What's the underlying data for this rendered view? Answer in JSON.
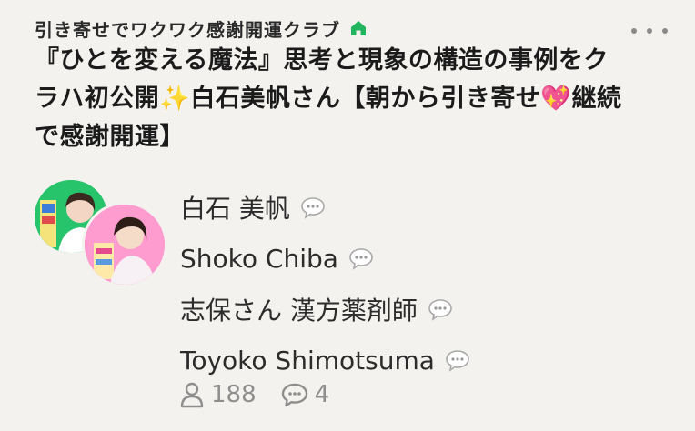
{
  "club": {
    "name": "引き寄せでワクワク感謝開運クラブ"
  },
  "room": {
    "title": "『ひとを変える魔法』思考と現象の構造の事例をクラハ初公開✨白石美帆さん【朝から引き寄せ💖継続で感謝開運】"
  },
  "speakers": [
    {
      "name": "白石 美帆"
    },
    {
      "name": "Shoko Chiba"
    },
    {
      "name": "志保さん 漢方薬剤師"
    },
    {
      "name": "Toyoko Shimotsuma"
    }
  ],
  "stats": {
    "listeners": "188",
    "comments": "4"
  },
  "colors": {
    "background": "#f3f2ee",
    "home": "#22b45e",
    "muted": "#8e8e8e",
    "text": "#1b1b1b"
  },
  "icons": {
    "home": "home-icon",
    "more": "more-icon",
    "chat": "chat-bubble-icon",
    "listeners": "person-icon",
    "comments": "comment-icon"
  }
}
